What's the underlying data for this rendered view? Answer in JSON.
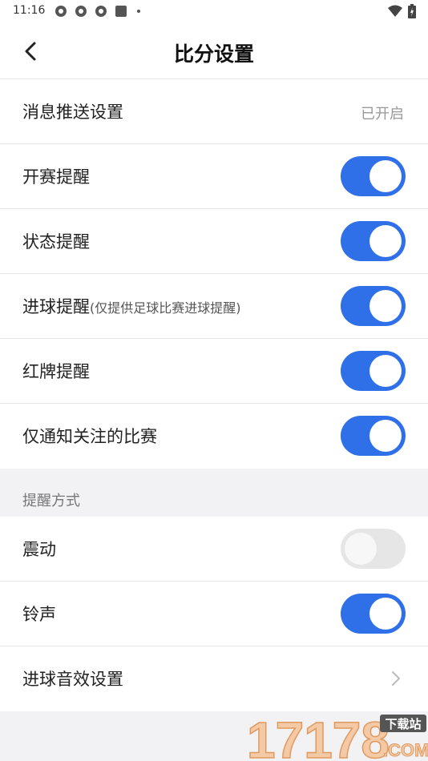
{
  "status_bar": {
    "time": "11:16",
    "notification_icons": [
      "app-icon",
      "app-icon",
      "app-icon",
      "square-icon"
    ],
    "wifi_icon": "wifi-icon",
    "battery_icon": "battery-charging-icon"
  },
  "header": {
    "back_icon": "chevron-left-icon",
    "title": "比分设置"
  },
  "push_section": {
    "push_settings": {
      "label": "消息推送设置",
      "value": "已开启"
    },
    "items": [
      {
        "label": "开赛提醒",
        "sub": "",
        "on": true
      },
      {
        "label": "状态提醒",
        "sub": "",
        "on": true
      },
      {
        "label": "进球提醒",
        "sub": "(仅提供足球比赛进球提醒)",
        "on": true
      },
      {
        "label": "红牌提醒",
        "sub": "",
        "on": true
      },
      {
        "label": "仅通知关注的比赛",
        "sub": "",
        "on": true
      }
    ]
  },
  "reminder_section": {
    "title": "提醒方式",
    "items": [
      {
        "label": "震动",
        "on": false
      },
      {
        "label": "铃声",
        "on": true
      }
    ],
    "goal_sound": {
      "label": "进球音效设置",
      "icon": "chevron-right-icon"
    }
  },
  "watermark": {
    "text": "17178",
    "badge": "下载站",
    "suffix": ".COM"
  },
  "colors": {
    "accent": "#2f6fe8",
    "toggle_off": "#e6e6e6",
    "background": "#f2f2f4"
  }
}
